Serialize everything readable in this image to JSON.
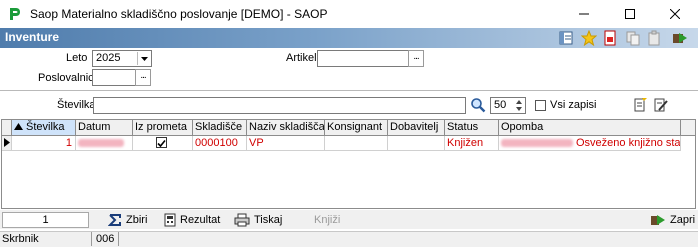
{
  "window": {
    "title": "Saop Materialno skladiščno poslovanje [DEMO] - SAOP",
    "icons": [
      "app-logo-icon",
      "minimize-icon",
      "maximize-icon",
      "close-icon"
    ]
  },
  "form": {
    "title": "Inventure",
    "toolbar_icons": [
      "layout-icon",
      "favorite-star-icon",
      "pdf-icon",
      "copy-icon",
      "paste-icon",
      "exit-icon"
    ]
  },
  "filters": {
    "leto_label": "Leto",
    "leto_value": "2025",
    "poslovalnica_label": "Poslovalnica",
    "poslovalnica_value": "",
    "artikel_label": "Artikel",
    "artikel_value": "",
    "dots": "...",
    "stevilka_label": "Številka",
    "stevilka_value": "",
    "count": "50",
    "vsi_zapisi_label": "Vsi zapisi"
  },
  "grid": {
    "columns": [
      "Številka",
      "Datum",
      "Iz prometa",
      "Skladišče",
      "Naziv skladišča",
      "Konsignant",
      "Dobavitelj",
      "Status",
      "Opomba"
    ],
    "rows": [
      {
        "stevilka": "1",
        "datum": "",
        "iz_prometa": true,
        "skladisce": "0000100",
        "naziv": "VP",
        "konsignant": "",
        "dobavitelj": "",
        "status": "Knjižen",
        "opomba": "Osveženo knjižno stanje"
      }
    ]
  },
  "footer": {
    "record_no": "1",
    "zbiri": "Zbiri",
    "rezultat": "Rezultat",
    "tiskaj": "Tiskaj",
    "knjizi": "Knjiži",
    "zapri": "Zapri"
  },
  "status": {
    "user": "Skrbnik",
    "code": "006"
  }
}
